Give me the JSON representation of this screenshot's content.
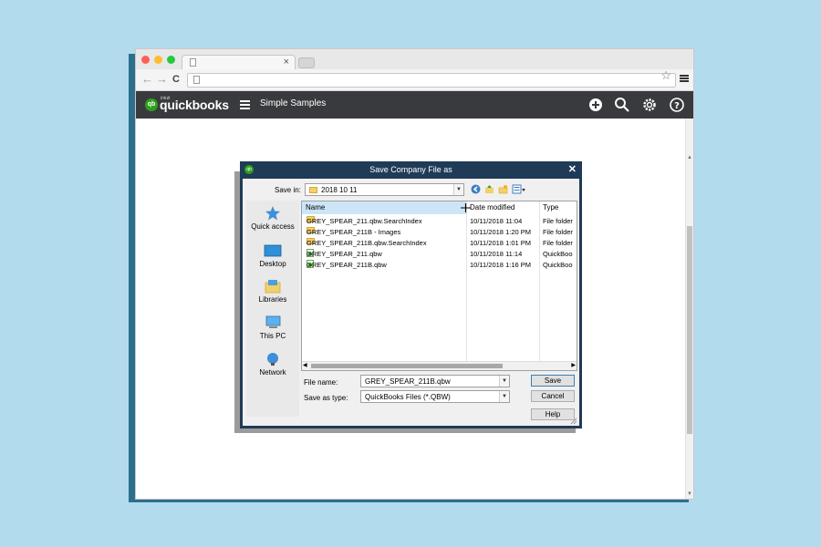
{
  "browser": {
    "traffic_light_colors": [
      "#ff5f57",
      "#febc2e",
      "#28c840"
    ],
    "tab_close": "×",
    "back": "←",
    "forward": "→",
    "reload": "C",
    "star": "☆"
  },
  "qb_header": {
    "logo_mark": "qb",
    "logo_small_text": "intuit",
    "logo_text": "quickbooks",
    "company": "Simple Samples",
    "brand_green": "#2ca01c",
    "bar_color": "#393a3d"
  },
  "dialog": {
    "title": "Save Company File as",
    "close": "✕",
    "save_in_label": "Save in:",
    "save_in_value": "2018 10 11",
    "columns": {
      "name": "Name",
      "date": "Date modified",
      "type": "Type"
    },
    "places": [
      {
        "label": "Quick access",
        "icon": "star-icon"
      },
      {
        "label": "Desktop",
        "icon": "desktop-icon"
      },
      {
        "label": "Libraries",
        "icon": "libraries-icon"
      },
      {
        "label": "This PC",
        "icon": "computer-icon"
      },
      {
        "label": "Network",
        "icon": "network-icon"
      }
    ],
    "files": [
      {
        "name": "GREY_SPEAR_211.qbw.SearchIndex",
        "date": "10/11/2018 11:04",
        "type": "File folder",
        "kind": "folder"
      },
      {
        "name": "GREY_SPEAR_211B - Images",
        "date": "10/11/2018 1:20 PM",
        "type": "File folder",
        "kind": "folder"
      },
      {
        "name": "GREY_SPEAR_211B.qbw.SearchIndex",
        "date": "10/11/2018 1:01 PM",
        "type": "File folder",
        "kind": "folder"
      },
      {
        "name": "GREY_SPEAR_211.qbw",
        "date": "10/11/2018 11:14",
        "type": "QuickBoo",
        "kind": "qbw"
      },
      {
        "name": "GREY_SPEAR_211B.qbw",
        "date": "10/11/2018 1:16 PM",
        "type": "QuickBoo",
        "kind": "qbw"
      }
    ],
    "file_name_label": "File name:",
    "file_name_value": "GREY_SPEAR_211B.qbw",
    "save_as_type_label": "Save as type:",
    "save_as_type_value": "QuickBooks Files (*.QBW)",
    "buttons": {
      "save": "Save",
      "cancel": "Cancel",
      "help": "Help"
    }
  }
}
